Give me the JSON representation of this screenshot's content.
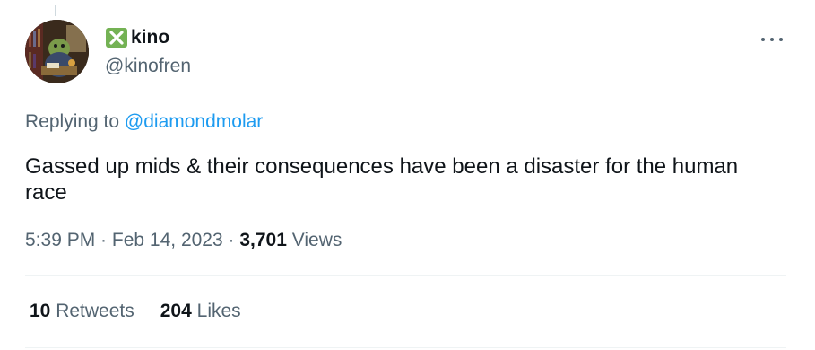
{
  "tweet": {
    "display_name": "kino",
    "handle": "@kinofren",
    "replying_prefix": "Replying to",
    "replying_to": "@diamondmolar",
    "text": "Gassed up mids & their consequences have been a disaster for the human race",
    "time": "5:39 PM",
    "sep": " · ",
    "date": "Feb 14, 2023",
    "views_count": "3,701",
    "views_label": "Views"
  },
  "stats": {
    "retweets_count": "10",
    "retweets_label": "Retweets",
    "likes_count": "204",
    "likes_label": "Likes"
  },
  "colors": {
    "text": "#0f1419",
    "secondary": "#536471",
    "link": "#1d9bf0",
    "x_emoji": "#74b254",
    "divider": "#eff3f4"
  },
  "icons": {
    "name_prefix": "cross-mark-button-icon",
    "more": "more-dots-icon"
  }
}
